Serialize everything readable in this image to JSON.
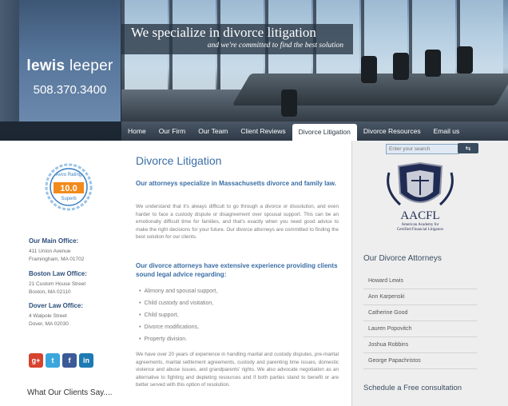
{
  "brand": {
    "name_first": "lewis",
    "name_last": "leeper",
    "phone": "508.370.3400"
  },
  "banner": {
    "title": "We specialize in divorce litigation",
    "subtitle": "and we're committed to find the best solution"
  },
  "nav": {
    "items": [
      "Home",
      "Our Firm",
      "Our Team",
      "Client Reviews",
      "Divorce Litigation",
      "Divorce Resources",
      "Email us"
    ],
    "active": "Divorce Litigation"
  },
  "badge": {
    "top": "Avvo",
    "rating_label": "Rating",
    "score": "10.0",
    "tier": "Superb"
  },
  "offices": [
    {
      "heading": "Our Main Office:",
      "line1": "411 Union Avenue",
      "line2": "Framingham, MA 01702"
    },
    {
      "heading": "Boston Law Office:",
      "line1": "21 Custom House Street",
      "line2": "Boston, MA 02110"
    },
    {
      "heading": "Dover Law Office:",
      "line1": "4 Walpole Street",
      "line2": "Dover, MA 02030"
    }
  ],
  "social": [
    "g+",
    "t",
    "f",
    "in"
  ],
  "clients_say": "What Our Clients Say....",
  "main": {
    "title": "Divorce Litigation",
    "lead1": "Our attorneys specialize in Massachusetts divorce and family law.",
    "para1": "We understand that it's always difficult to go through a divorce or dissolution, and even harder to face a custody dispute or disagreement over spousal support. This can be an emotionally difficult time for families, and that's exactly when you need good advice to make the right decisions for your future. Our divorce attorneys are committed to finding the best solution for our clients.",
    "lead2": "Our divorce attorneys have extensive experience providing clients sound legal advice regarding:",
    "services": [
      "Alimony and spousal support,",
      "Child custody and visitation,",
      "Child support,",
      "Divorce modifications,",
      "Property division."
    ],
    "para2": "We have over 20 years of experience in handling marital and custody disputes, pre-marital agreements, marital settlement agreements, custody and parenting time issues, domestic violence and abuse issues, and grandparents' rights. We also advocate negotiation as an alternative to fighting and depleting resources and if both parties stand to benefit or are better served with this option of resolution."
  },
  "search": {
    "placeholder": "Enter your search",
    "button": "⇆"
  },
  "aacfl": {
    "acronym": "AACFL",
    "line1": "American Academy for",
    "line2": "Certified Financial Litigators"
  },
  "attorneys": {
    "heading": "Our Divorce Attorneys",
    "names": [
      "Howard Lewis",
      "Ann Karpenski",
      "Catherine Good",
      "Lauren Popovitch",
      "Joshua Robbins",
      "George Papachristos"
    ]
  },
  "schedule": "Schedule a Free consultation",
  "colors": {
    "accent": "#3a6ea5",
    "dark": "#2e3b4b"
  }
}
